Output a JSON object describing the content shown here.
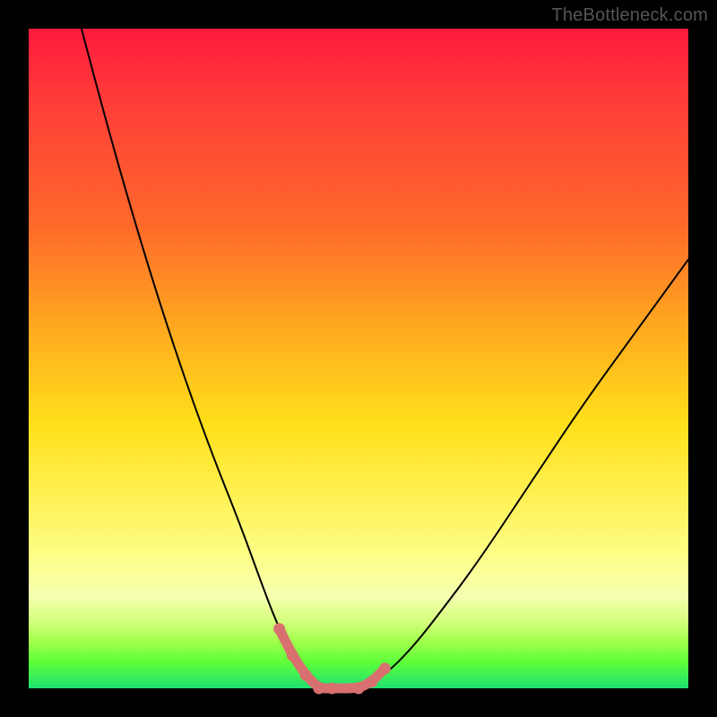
{
  "watermark": "TheBottleneck.com",
  "chart_data": {
    "type": "line",
    "title": "",
    "xlabel": "",
    "ylabel": "",
    "xlim": [
      0,
      100
    ],
    "ylim": [
      0,
      100
    ],
    "series": [
      {
        "name": "black-curve",
        "color": "#000000",
        "stroke_width": 2,
        "x": [
          8,
          12,
          16,
          20,
          24,
          28,
          32,
          36,
          38,
          40,
          42,
          44,
          46,
          50,
          54,
          58,
          62,
          68,
          76,
          84,
          92,
          100
        ],
        "values": [
          100,
          85,
          71,
          58,
          46,
          35,
          25,
          14,
          9,
          5,
          2,
          0,
          0,
          0,
          2,
          6,
          11,
          19,
          31,
          43,
          54,
          65
        ]
      },
      {
        "name": "salmon-segment",
        "color": "#d87070",
        "stroke_width": 11,
        "x": [
          38,
          40,
          42,
          44,
          46,
          50,
          52,
          54
        ],
        "values": [
          9,
          5,
          2,
          0,
          0,
          0,
          1,
          3
        ]
      }
    ],
    "annotations": []
  }
}
